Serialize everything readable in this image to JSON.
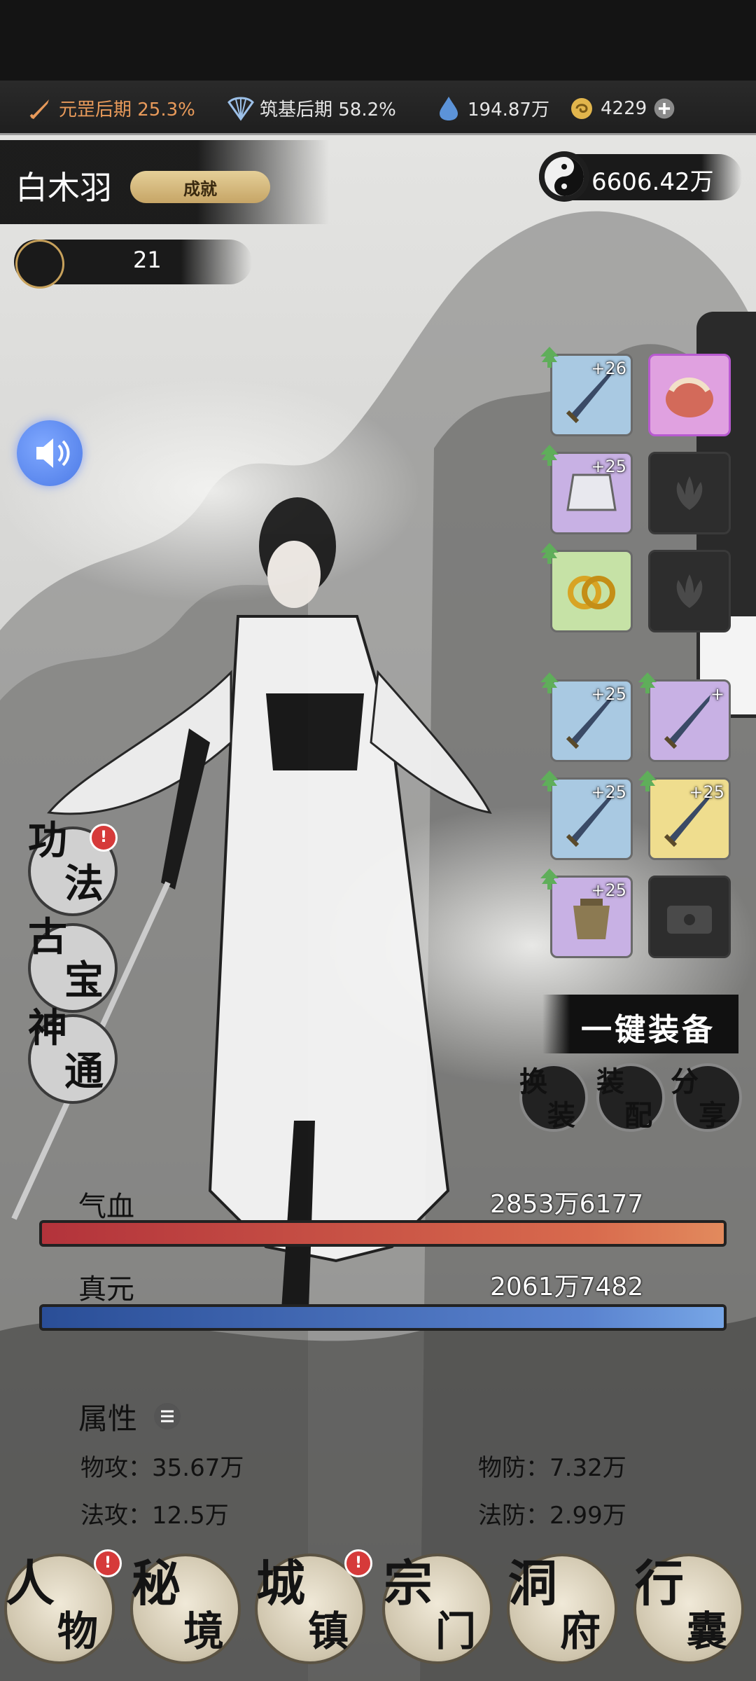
{
  "resources": [
    {
      "icon": "sword-icon",
      "text": "元罡后期 25.3%",
      "color": "#e89a5a"
    },
    {
      "icon": "fan-icon",
      "text": "筑基后期 58.2%",
      "color": "#e6e6e6"
    },
    {
      "icon": "spirit-drop-icon",
      "text": "194.87万",
      "color": "#e6e6e6"
    },
    {
      "icon": "coin-icon",
      "text": "4229",
      "color": "#e6e6e6"
    }
  ],
  "add_currency_icon": "plus-icon",
  "player": {
    "name": "白木羽",
    "achievement_label": "成就",
    "level": "21",
    "currency": "6606.42万"
  },
  "equipment": [
    {
      "enh": "+26",
      "rarity": "blue",
      "item": "dagger"
    },
    {
      "enh": "",
      "rarity": "pink",
      "item": "pouch"
    },
    {
      "enh": "+25",
      "rarity": "purple",
      "item": "armor"
    },
    {
      "enh": "",
      "rarity": "empty",
      "item": "lotus"
    },
    {
      "enh": "",
      "rarity": "green",
      "item": "rings"
    },
    {
      "enh": "",
      "rarity": "empty",
      "item": "lotus"
    },
    {
      "enh": "+25",
      "rarity": "blue",
      "item": "sword"
    },
    {
      "enh": "+",
      "rarity": "purple",
      "item": "sword"
    },
    {
      "enh": "+25",
      "rarity": "blue",
      "item": "sword"
    },
    {
      "enh": "+25",
      "rarity": "gold",
      "item": "sword"
    },
    {
      "enh": "+25",
      "rarity": "purple",
      "item": "cauldron"
    },
    {
      "enh": "",
      "rarity": "empty",
      "item": "locked"
    }
  ],
  "skills": [
    {
      "top": "功",
      "bottom": "法",
      "badge": "!"
    },
    {
      "top": "古",
      "bottom": "宝",
      "badge": ""
    },
    {
      "top": "神",
      "bottom": "通",
      "badge": ""
    }
  ],
  "actions": {
    "one_key_equip": "一键装备",
    "swap": [
      "换",
      "装"
    ],
    "assemble": [
      "装",
      "配"
    ],
    "share": [
      "分",
      "享"
    ]
  },
  "stats": {
    "hp_label": "气血",
    "hp_value": "2853万6177",
    "mp_label": "真元",
    "mp_value": "2061万7482",
    "attr_title": "属性",
    "phys_atk": "物攻：35.67万",
    "phys_def": "物防：7.32万",
    "mag_atk": "法攻：12.5万",
    "mag_def": "法防：2.99万"
  },
  "nav": [
    {
      "a": "人",
      "b": "物",
      "badge": "!"
    },
    {
      "a": "秘",
      "b": "境",
      "badge": ""
    },
    {
      "a": "城",
      "b": "镇",
      "badge": "!"
    },
    {
      "a": "宗",
      "b": "门",
      "badge": ""
    },
    {
      "a": "洞",
      "b": "府",
      "badge": ""
    },
    {
      "a": "行",
      "b": "囊",
      "badge": ""
    }
  ]
}
